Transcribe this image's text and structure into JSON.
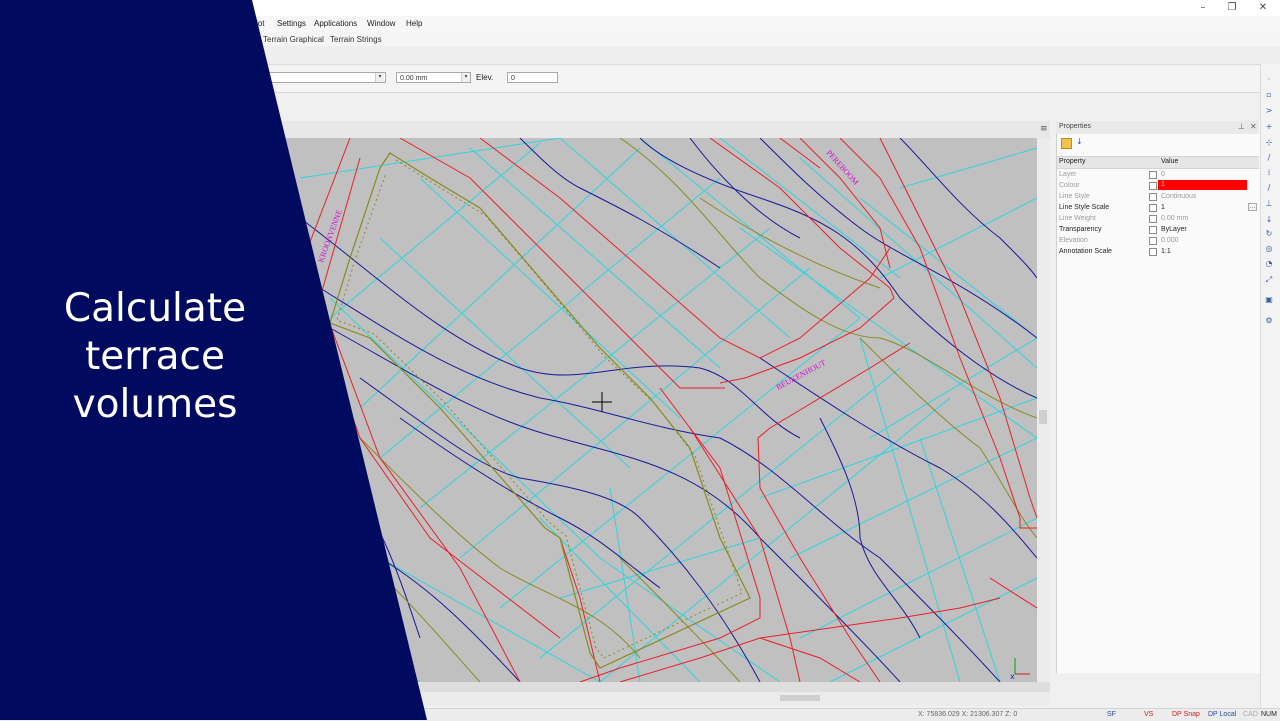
{
  "overlay": {
    "caption": "Calculate\nterrace\nvolumes",
    "background_color": "#000a5e"
  },
  "menu": {
    "items": [
      "lot",
      "Settings",
      "Applications",
      "Window",
      "Help"
    ]
  },
  "window_controls": {
    "minimize": "–",
    "restore": "❐",
    "close": "✕"
  },
  "ribbon_tabs": [
    "Terrain Graphical",
    "Terrain Strings"
  ],
  "toolbar": {
    "lineweight_value": "0.00 mm",
    "elev_label": "Elev.",
    "elev_value": "0"
  },
  "properties": {
    "title": "Properties",
    "column_property": "Property",
    "column_value": "Value",
    "rows": [
      {
        "name": "Layer",
        "value": "0",
        "active": false
      },
      {
        "name": "Colour",
        "value": "1",
        "active": false,
        "color": "#ff0000"
      },
      {
        "name": "Line Style",
        "value": "Continuous",
        "active": false
      },
      {
        "name": "Line Style Scale",
        "value": "1",
        "active": true
      },
      {
        "name": "Line Weight",
        "value": "0.00 mm",
        "active": false
      },
      {
        "name": "Transparency",
        "value": "ByLayer",
        "active": true
      },
      {
        "name": "Elevation",
        "value": "0.000",
        "active": false
      },
      {
        "name": "Annotation Scale",
        "value": "1:1",
        "active": true
      }
    ]
  },
  "drawing": {
    "street_labels": [
      "KROONVENNE",
      "PEREBOOM",
      "BEUKENHOUT"
    ],
    "colors": {
      "background": "#c0c0c0",
      "red": "#e8202a",
      "blue": "#1a1a9a",
      "cyan": "#30d4e0",
      "olive": "#8a8a20",
      "magenta": "#d010d0"
    }
  },
  "status": {
    "coordinates": "X: 75836.029 X: 21306.307 Z: 0",
    "items": [
      "SF",
      "VS",
      "DP Snap",
      "DP Local",
      "CAD",
      "NUM"
    ]
  }
}
